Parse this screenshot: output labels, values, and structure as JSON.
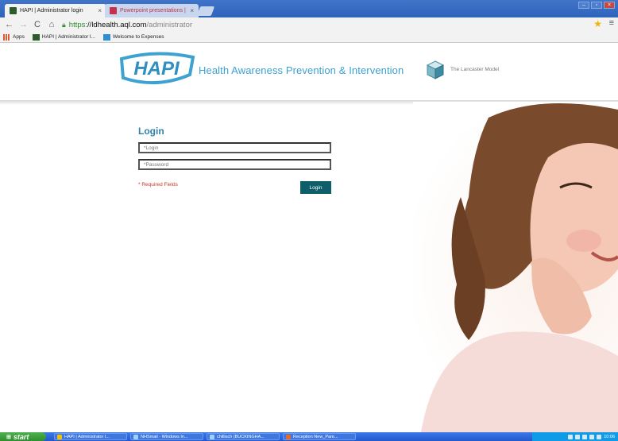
{
  "browser": {
    "tabs": [
      {
        "title": "HAPI | Administrator login",
        "favicon_color": "#2b5d2b"
      },
      {
        "title": "Powerpoint presentations |",
        "favicon_color": "#c7304b"
      }
    ],
    "url": {
      "scheme": "https:",
      "host": "//ldhealth.aql.com",
      "path": "/administrator"
    },
    "bookmarks": [
      {
        "label": "Apps"
      },
      {
        "label": "HAPI | Administrator l..."
      },
      {
        "label": "Welcome to Expenses"
      }
    ]
  },
  "header": {
    "logo_text": "HAPI",
    "tagline": "Health Awareness Prevention & Intervention",
    "model_text": "The Lancaster Model"
  },
  "login": {
    "title": "Login",
    "login_placeholder": "*Login",
    "password_placeholder": "*Password",
    "required_text": "* Required Fields",
    "button_label": "Login"
  },
  "taskbar": {
    "start_label": "start",
    "tasks": [
      {
        "label": "HAPI | Administrator l..."
      },
      {
        "label": "NHSmail - Windows In..."
      },
      {
        "label": "chillisch (BUCKINGHA..."
      },
      {
        "label": "Reception New_Pare..."
      }
    ],
    "clock": "10:06"
  },
  "colors": {
    "accent": "#2f82a9",
    "tagline": "#3da2cf",
    "button": "#0f5f6a",
    "required": "#c0392b"
  }
}
